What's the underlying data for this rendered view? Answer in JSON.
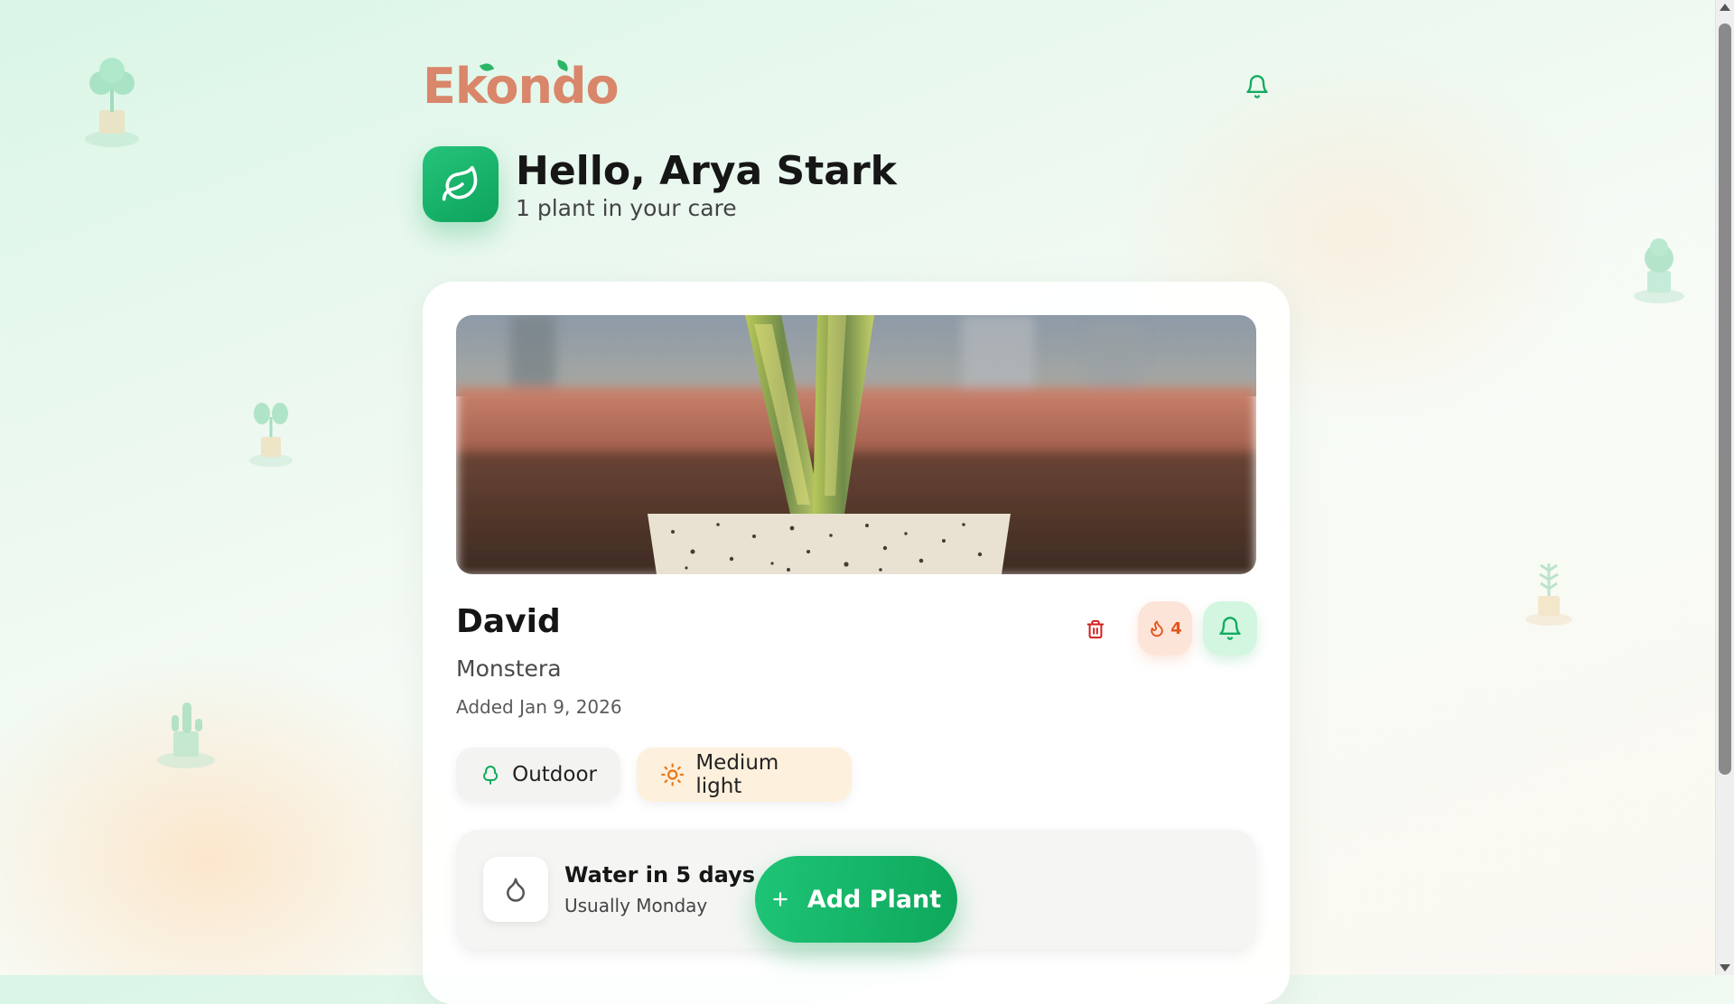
{
  "header": {
    "logo_text": "Ekondo",
    "notifications_icon": "bell-icon"
  },
  "greeting": {
    "avatar_icon": "leaf-icon",
    "title": "Hello, Arya Stark",
    "subtitle": "1 plant in your care"
  },
  "plant_card": {
    "photo_alt": "Snake plant in speckled pot",
    "name": "David",
    "species": "Monstera",
    "added": "Added Jan 9, 2026",
    "actions": {
      "delete_icon": "trash-icon",
      "streak_icon": "flame-icon",
      "streak_count": "4",
      "reminder_icon": "bell-icon"
    },
    "tags": [
      {
        "label": "Outdoor",
        "icon": "tree-icon"
      },
      {
        "label": "Medium light",
        "icon": "sun-icon"
      }
    ],
    "watering": {
      "icon": "water-drop-icon",
      "title": "Water in 5 days",
      "subtitle": "Usually Monday"
    }
  },
  "add_plant_button": {
    "icon": "plus-icon",
    "label": "Add Plant"
  },
  "colors": {
    "brand_green": "#12ab60",
    "logo_color": "#d9866a",
    "streak_orange": "#e4541c",
    "delete_red": "#d32020"
  }
}
